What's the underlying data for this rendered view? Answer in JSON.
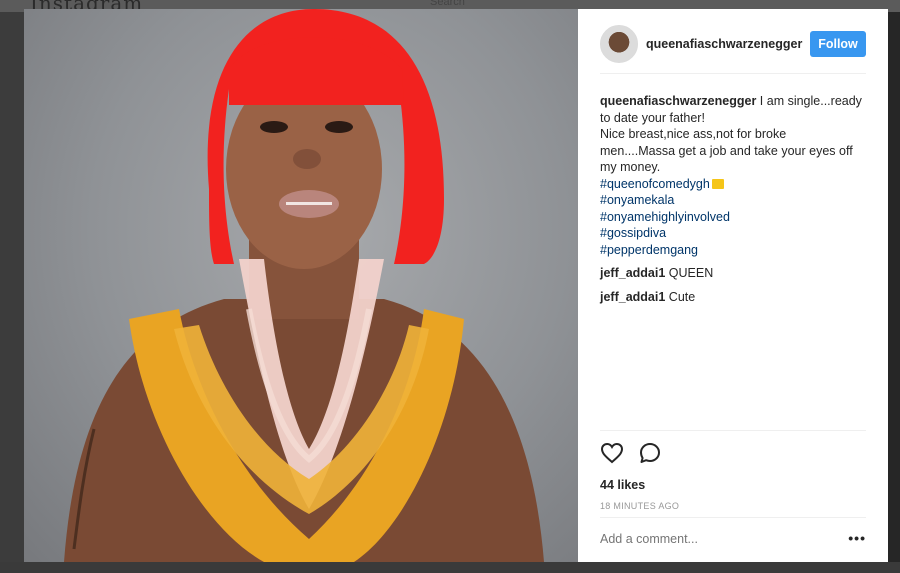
{
  "background": {
    "logo_text": "Instagram",
    "search_ghost": "Search"
  },
  "post": {
    "username": "queenafiaschwarzenegger",
    "follow_label": "Follow",
    "caption_user": "queenafiaschwarzenegger",
    "caption_lines": [
      "I am single...ready to date your father!",
      "Nice breast,nice ass,not for broke men....Massa get a job and take your eyes off my money."
    ],
    "hashtags": [
      "#queenofcomedygh",
      "#onyamekala",
      "#onyamehighlyinvolved",
      "#gossipdiva",
      "#pepperdemgang"
    ],
    "comments": [
      {
        "user": "jeff_addai1",
        "text": "QUEEN"
      },
      {
        "user": "jeff_addai1",
        "text": "Cute"
      }
    ],
    "likes": "44 likes",
    "time": "18 MINUTES AGO",
    "add_comment_placeholder": "Add a comment...",
    "more_label": "•••"
  },
  "colors": {
    "follow_button": "#3897f0",
    "hashtag": "#003569",
    "hair": "#f2221f"
  },
  "icons": [
    "heart-icon",
    "comment-icon",
    "more-options-icon",
    "crown-emoji-icon"
  ]
}
